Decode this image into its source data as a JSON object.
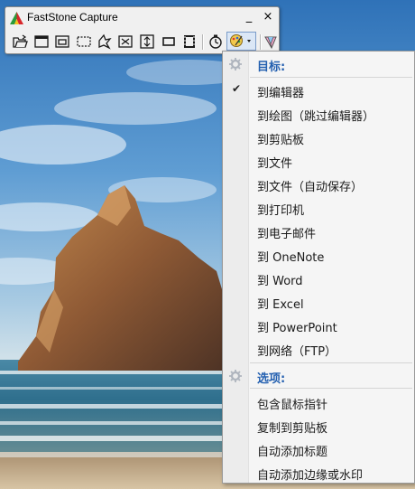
{
  "app": {
    "title": "FastStone Capture",
    "minimize_glyph": "_",
    "close_glyph": "×"
  },
  "toolbar": {
    "buttons": [
      {
        "name": "open-file-icon"
      },
      {
        "name": "capture-active-window-icon"
      },
      {
        "name": "capture-window-object-icon"
      },
      {
        "name": "capture-rectangle-icon"
      },
      {
        "name": "capture-freehand-icon"
      },
      {
        "name": "capture-full-screen-icon"
      },
      {
        "name": "capture-scrolling-window-icon"
      },
      {
        "name": "capture-fixed-region-icon"
      },
      {
        "name": "screen-recorder-icon"
      },
      {
        "name": "delay-timer-icon"
      },
      {
        "name": "output-destination-icon"
      },
      {
        "name": "settings-icon"
      }
    ]
  },
  "menu": {
    "target_header": "目标:",
    "targets": [
      {
        "label": "到编辑器",
        "checked": true
      },
      {
        "label": "到绘图（跳过编辑器）",
        "checked": false
      },
      {
        "label": "到剪贴板",
        "checked": false
      },
      {
        "label": "到文件",
        "checked": false
      },
      {
        "label": "到文件（自动保存）",
        "checked": false
      },
      {
        "label": "到打印机",
        "checked": false
      },
      {
        "label": "到电子邮件",
        "checked": false
      },
      {
        "label": "到 OneNote",
        "checked": false
      },
      {
        "label": "到 Word",
        "checked": false
      },
      {
        "label": "到 Excel",
        "checked": false
      },
      {
        "label": "到 PowerPoint",
        "checked": false
      },
      {
        "label": "到网络（FTP）",
        "checked": false
      }
    ],
    "options_header": "选项:",
    "options": [
      {
        "label": "包含鼠标指针"
      },
      {
        "label": "复制到剪贴板"
      },
      {
        "label": "自动添加标题"
      },
      {
        "label": "自动添加边缘或水印"
      }
    ]
  },
  "colors": {
    "header_text": "#2460b0",
    "sky": "#3c82c4",
    "sea": "#3a7a9a"
  }
}
